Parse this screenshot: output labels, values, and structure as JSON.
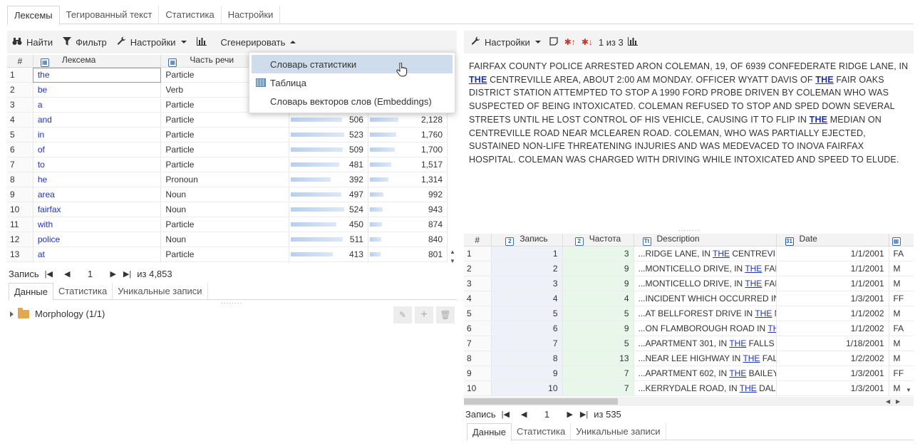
{
  "top_tabs": [
    "Лексемы",
    "Тегированный текст",
    "Статистика",
    "Настройки"
  ],
  "left_toolbar": {
    "find": "Найти",
    "filter": "Фильтр",
    "settings": "Настройки",
    "generate": "Сгенерировать"
  },
  "left_grid": {
    "headers": {
      "rownum": "#",
      "lexeme": "Лексема",
      "pos": "Часть речи"
    },
    "rows": [
      {
        "n": "1",
        "lex": "the",
        "pos": "Particle",
        "v1": "",
        "v2": "",
        "f1": 0,
        "f2": 0
      },
      {
        "n": "2",
        "lex": "be",
        "pos": "Verb",
        "v1": "",
        "v2": "",
        "f1": 0,
        "f2": 0
      },
      {
        "n": "3",
        "lex": "a",
        "pos": "Particle",
        "v1": "",
        "v2": "",
        "f1": 0,
        "f2": 0
      },
      {
        "n": "4",
        "lex": "and",
        "pos": "Particle",
        "v1": "506",
        "v2": "2,128",
        "f1": 0.72,
        "f2": 0.4
      },
      {
        "n": "5",
        "lex": "in",
        "pos": "Particle",
        "v1": "523",
        "v2": "1,760",
        "f1": 0.75,
        "f2": 0.37
      },
      {
        "n": "6",
        "lex": "of",
        "pos": "Particle",
        "v1": "509",
        "v2": "1,700",
        "f1": 0.73,
        "f2": 0.35
      },
      {
        "n": "7",
        "lex": "to",
        "pos": "Particle",
        "v1": "481",
        "v2": "1,517",
        "f1": 0.68,
        "f2": 0.3
      },
      {
        "n": "8",
        "lex": "he",
        "pos": "Pronoun",
        "v1": "392",
        "v2": "1,314",
        "f1": 0.56,
        "f2": 0.26
      },
      {
        "n": "9",
        "lex": "area",
        "pos": "Noun",
        "v1": "497",
        "v2": "992",
        "f1": 0.71,
        "f2": 0.19
      },
      {
        "n": "10",
        "lex": "fairfax",
        "pos": "Noun",
        "v1": "524",
        "v2": "943",
        "f1": 0.75,
        "f2": 0.18
      },
      {
        "n": "11",
        "lex": "with",
        "pos": "Particle",
        "v1": "450",
        "v2": "874",
        "f1": 0.64,
        "f2": 0.17
      },
      {
        "n": "12",
        "lex": "police",
        "pos": "Noun",
        "v1": "511",
        "v2": "840",
        "f1": 0.73,
        "f2": 0.16
      },
      {
        "n": "13",
        "lex": "at",
        "pos": "Particle",
        "v1": "413",
        "v2": "801",
        "f1": 0.59,
        "f2": 0.15
      }
    ]
  },
  "left_pager": {
    "label": "Запись",
    "page": "1",
    "total": "из 4,853"
  },
  "left_sub_tabs": [
    "Данные",
    "Статистика",
    "Уникальные записи"
  ],
  "tree": {
    "label": "Morphology (1/1)"
  },
  "menu": {
    "items": [
      "Словарь статистики",
      "Таблица",
      "Словарь векторов слов (Embeddings)"
    ]
  },
  "right_toolbar": {
    "settings": "Настройки",
    "counter": "1 из 3"
  },
  "article": {
    "parts": [
      "FAIRFAX COUNTY POLICE ARRESTED ARON COLEMAN, 19, OF 6939 CONFEDERATE RIDGE LANE, IN ",
      "THE",
      " CENTREVILLE AREA, ABOUT 2:00 AM MONDAY. OFFICER WYATT DAVIS OF ",
      "THE",
      " FAIR OAKS DISTRICT STATION ATTEMPTED TO STOP A 1990 FORD PROBE DRIVEN BY COLEMAN WHO WAS SUSPECTED OF BEING INTOXICATED. COLEMAN REFUSED TO STOP AND SPED DOWN SEVERAL STREETS UNTIL HE LOST CONTROL OF HIS VEHICLE, CAUSING IT TO FLIP IN ",
      "THE",
      " MEDIAN ON CENTREVILLE ROAD NEAR MCLEAREN ROAD. COLEMAN, WHO WAS PARTIALLY EJECTED, SUSTAINED NON-LIFE THREATENING INJURIES AND WAS MEDEVACED TO INOVA FAIRFAX HOSPITAL. COLEMAN WAS CHARGED WITH DRIVING WHILE INTOXICATED AND SPEED TO ELUDE."
    ]
  },
  "right_grid": {
    "headers": {
      "rownum": "#",
      "record": "Запись",
      "freq": "Частота",
      "desc": "Description",
      "date": "Date"
    },
    "rows": [
      {
        "n": "1",
        "rec": "1",
        "freq": "3",
        "pre": "...RIDGE LANE, IN ",
        "hl": "THE",
        "post": " CENTREVILL",
        "date": "1/1/2001",
        "x": "FA"
      },
      {
        "n": "2",
        "rec": "2",
        "freq": "9",
        "pre": "...MONTICELLO DRIVE, IN ",
        "hl": "THE",
        "post": " FALL",
        "date": "1/1/2001",
        "x": "M"
      },
      {
        "n": "3",
        "rec": "3",
        "freq": "9",
        "pre": "...MONTICELLO DRIVE, IN ",
        "hl": "THE",
        "post": " FALL",
        "date": "1/1/2001",
        "x": "M"
      },
      {
        "n": "4",
        "rec": "4",
        "freq": "4",
        "pre": "...INCIDENT WHICH OCCURRED IN",
        "hl": "",
        "post": "",
        "date": "1/3/2001",
        "x": "FF"
      },
      {
        "n": "5",
        "rec": "5",
        "freq": "5",
        "pre": "...AT BELLFOREST DRIVE IN ",
        "hl": "THE",
        "post": " ME",
        "date": "1/1/2002",
        "x": "M"
      },
      {
        "n": "6",
        "rec": "6",
        "freq": "9",
        "pre": "...ON FLAMBOROUGH ROAD IN ",
        "hl": "TH",
        "post": "",
        "date": "1/1/2002",
        "x": "FA"
      },
      {
        "n": "7",
        "rec": "7",
        "freq": "5",
        "pre": "...APARTMENT 301, IN ",
        "hl": "THE",
        "post": " FALLS C",
        "date": "1/18/2001",
        "x": "M"
      },
      {
        "n": "8",
        "rec": "8",
        "freq": "13",
        "pre": "...NEAR LEE HIGHWAY IN ",
        "hl": "THE",
        "post": " FALL",
        "date": "1/2/2002",
        "x": "M"
      },
      {
        "n": "9",
        "rec": "9",
        "freq": "7",
        "pre": "...APARTMENT 602, IN ",
        "hl": "THE",
        "post": " BAILEYS",
        "date": "1/3/2001",
        "x": "FF"
      },
      {
        "n": "10",
        "rec": "10",
        "freq": "7",
        "pre": "...KERRYDALE ROAD, IN ",
        "hl": "THE",
        "post": " DALE",
        "date": "1/3/2001",
        "x": "M"
      }
    ]
  },
  "right_pager": {
    "label": "Запись",
    "page": "1",
    "total": "из 535"
  },
  "right_sub_tabs": [
    "Данные",
    "Статистика",
    "Уникальные записи"
  ]
}
